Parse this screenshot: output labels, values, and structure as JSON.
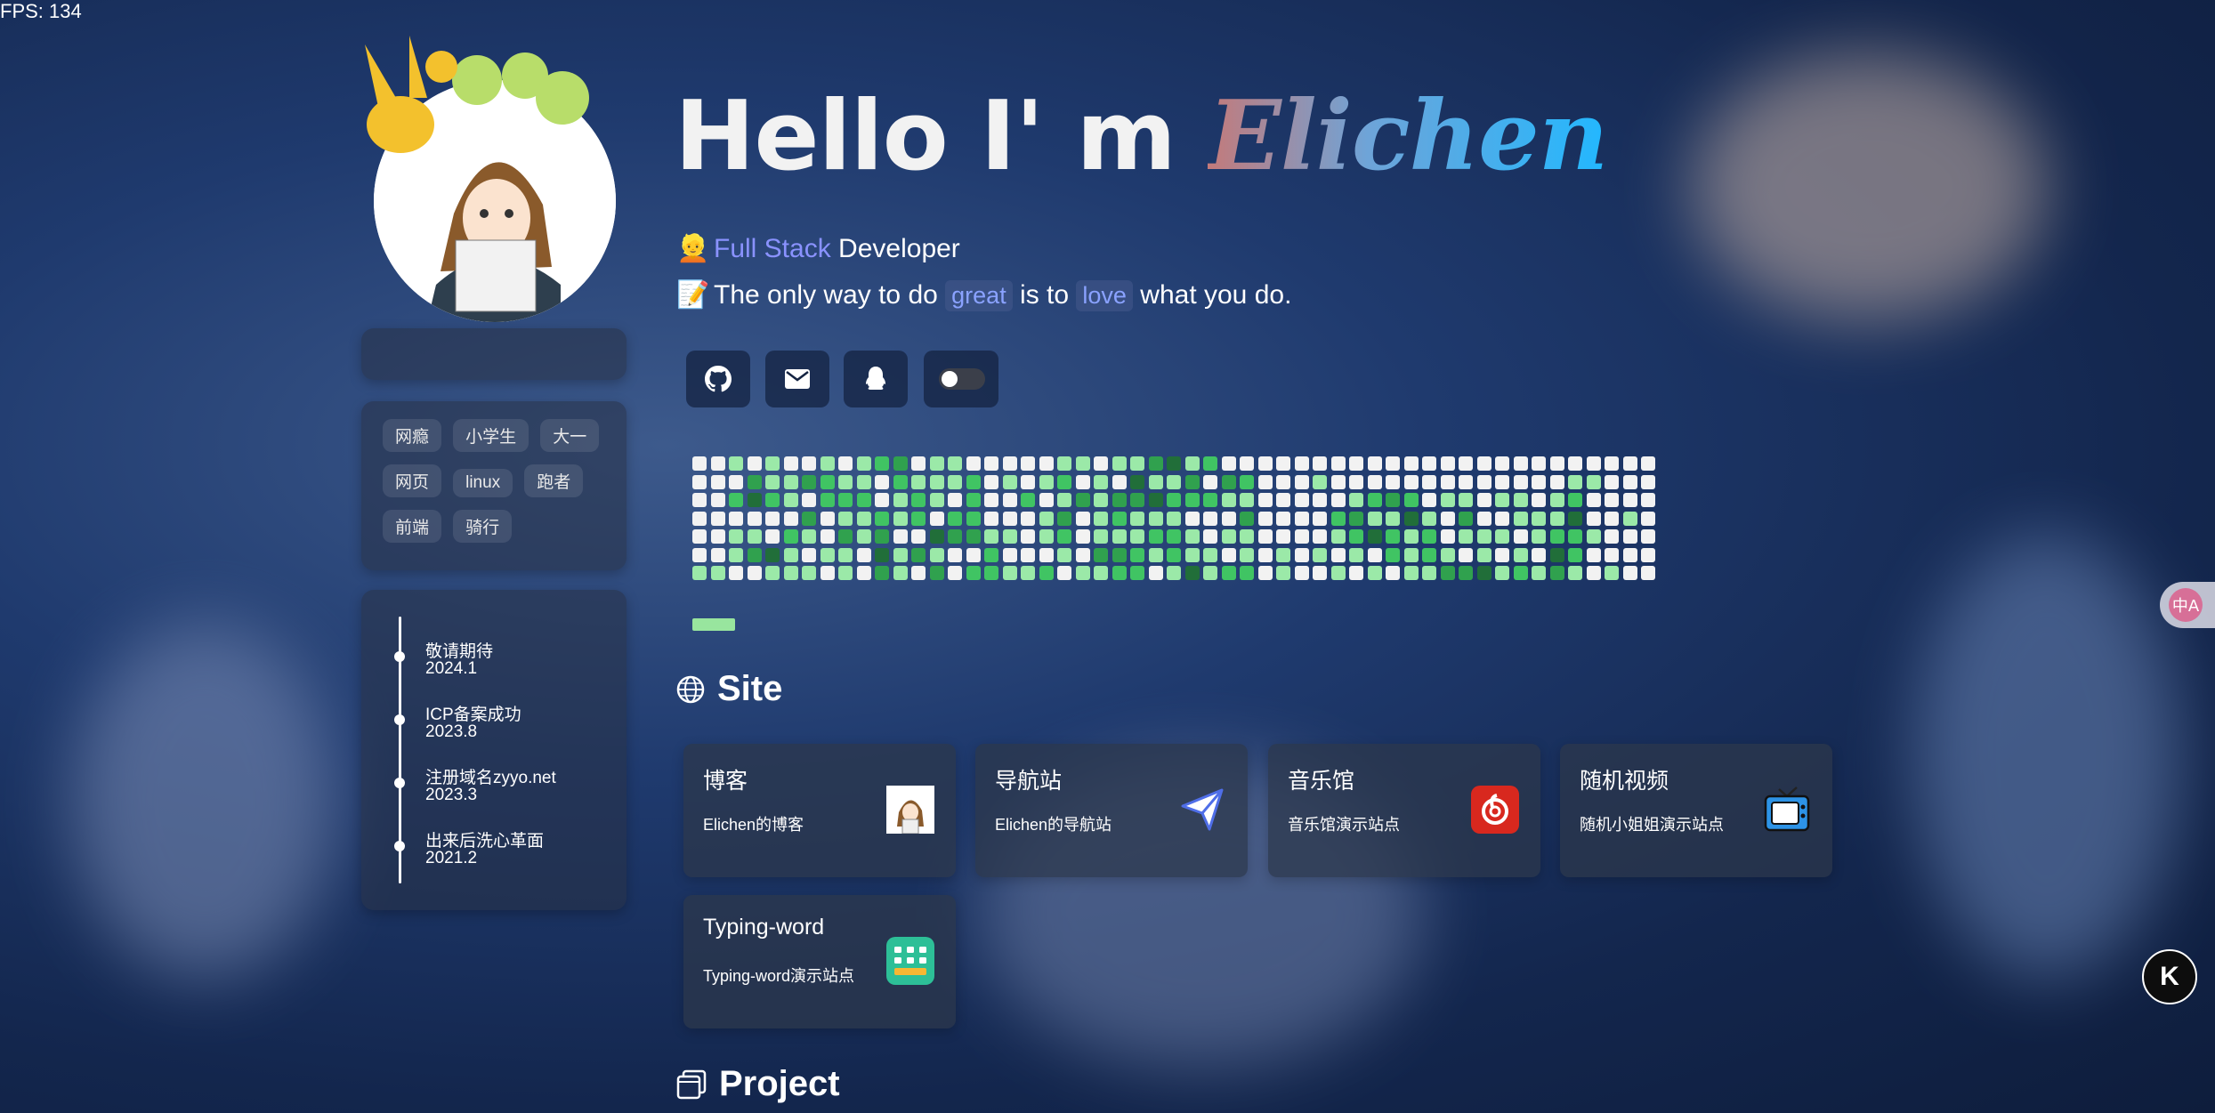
{
  "fps": "FPS: 134",
  "hero": {
    "greeting": "Hello I' m ",
    "name": "Elichen"
  },
  "intro": {
    "role_emoji": "👱",
    "role_accent": "Full Stack",
    "role_rest": " Developer",
    "quote_emoji": "📝",
    "quote_parts": [
      "The only way to do",
      "great",
      "is to",
      "love",
      "what you do."
    ]
  },
  "social": [
    {
      "name": "github-icon"
    },
    {
      "name": "email-icon"
    },
    {
      "name": "qq-icon"
    },
    {
      "name": "theme-toggle"
    }
  ],
  "tags": [
    "网瘾",
    "小学生",
    "大一",
    "网页",
    "linux",
    "跑者",
    "前端",
    "骑行"
  ],
  "timeline": [
    {
      "title": "敬请期待",
      "date": "2024.1"
    },
    {
      "title": "ICP备案成功",
      "date": "2023.8"
    },
    {
      "title": "注册域名zyyo.net",
      "date": "2023.3"
    },
    {
      "title": "出来后洗心革面",
      "date": "2021.2"
    }
  ],
  "sections": {
    "site": "Site",
    "project": "Project"
  },
  "sites": [
    {
      "title": "博客",
      "desc": "Elichen的博客",
      "icon": "avatar-thumbnail"
    },
    {
      "title": "导航站",
      "desc": "Elichen的导航站",
      "icon": "paper-plane-icon"
    },
    {
      "title": "音乐馆",
      "desc": "音乐馆演示站点",
      "icon": "netease-music-icon"
    },
    {
      "title": "随机视频",
      "desc": "随机小姐姐演示站点",
      "icon": "tv-icon"
    },
    {
      "title": "Typing-word",
      "desc": "Typing-word演示站点",
      "icon": "keyboard-icon"
    }
  ],
  "float": {
    "translate_label": "中A",
    "k_label": "K"
  },
  "colors": {
    "accent": "#8a92ff",
    "heat_levels": [
      "#f2f2f2",
      "#9be9a8",
      "#40c463",
      "#30a14e",
      "#216e39"
    ]
  }
}
